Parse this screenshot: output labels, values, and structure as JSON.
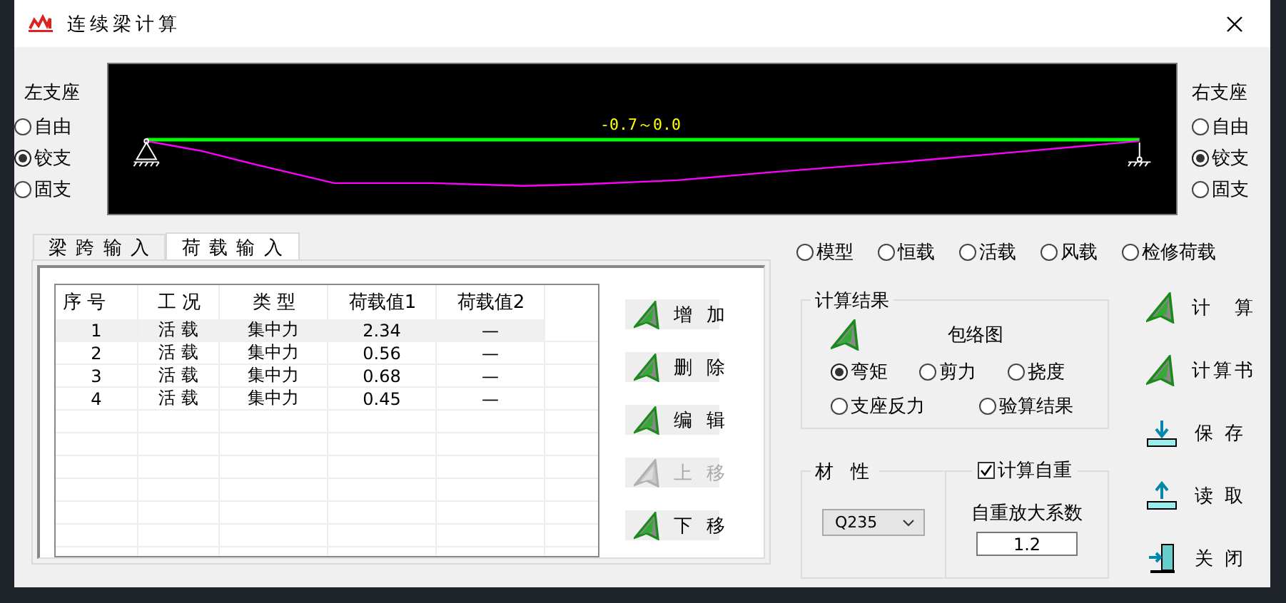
{
  "window": {
    "title": "连续梁计算"
  },
  "left_support": {
    "label": "左支座",
    "options": [
      {
        "label": "自由",
        "selected": false
      },
      {
        "label": "铰支",
        "selected": true
      },
      {
        "label": "固支",
        "selected": false
      }
    ]
  },
  "diagram": {
    "range_label": "-0.7～0.0"
  },
  "right_support": {
    "label": "右支座",
    "options": [
      {
        "label": "自由",
        "selected": false
      },
      {
        "label": "铰支",
        "selected": true
      },
      {
        "label": "固支",
        "selected": false
      }
    ]
  },
  "tabs": [
    {
      "label": "梁 跨 输 入",
      "selected": false
    },
    {
      "label": "荷 载 输 入",
      "selected": true
    }
  ],
  "load_table": {
    "columns": [
      "序 号",
      "工 况",
      "类 型",
      "荷载值1",
      "荷载值2"
    ],
    "rows": [
      {
        "cells": [
          "1",
          "活 载",
          "集中力",
          "2.34",
          "—"
        ],
        "selected": true
      },
      {
        "cells": [
          "2",
          "活 载",
          "集中力",
          "0.56",
          "—"
        ],
        "selected": false
      },
      {
        "cells": [
          "3",
          "活 载",
          "集中力",
          "0.68",
          "—"
        ],
        "selected": false
      },
      {
        "cells": [
          "4",
          "活 载",
          "集中力",
          "0.45",
          "—"
        ],
        "selected": false
      }
    ]
  },
  "table_buttons": [
    {
      "label": "增 加",
      "disabled": false
    },
    {
      "label": "删 除",
      "disabled": false
    },
    {
      "label": "编 辑",
      "disabled": false
    },
    {
      "label": "上 移",
      "disabled": true
    },
    {
      "label": "下 移",
      "disabled": false
    }
  ],
  "view_options": [
    {
      "label": "模型",
      "selected": false
    },
    {
      "label": "恒载",
      "selected": false
    },
    {
      "label": "活载",
      "selected": false
    },
    {
      "label": "风载",
      "selected": false
    },
    {
      "label": "检修荷载",
      "selected": false
    }
  ],
  "results_group": {
    "title": "计算结果",
    "envelope_label": "包络图",
    "options": [
      {
        "label": "弯矩",
        "selected": true
      },
      {
        "label": "剪力",
        "selected": false
      },
      {
        "label": "挠度",
        "selected": false
      },
      {
        "label": "支座反力",
        "selected": false
      },
      {
        "label": "验算结果",
        "selected": false
      }
    ]
  },
  "material": {
    "title": "材 性",
    "value": "Q235"
  },
  "self_weight": {
    "label": "计算自重",
    "checked": true,
    "factor_label": "自重放大系数",
    "factor": "1.2"
  },
  "actions": [
    {
      "label": "计　算",
      "kind": "triangle"
    },
    {
      "label": "计算书",
      "kind": "triangle"
    },
    {
      "label": "保 存",
      "kind": "save"
    },
    {
      "label": "读 取",
      "kind": "load"
    },
    {
      "label": "关 闭",
      "kind": "exit"
    }
  ]
}
